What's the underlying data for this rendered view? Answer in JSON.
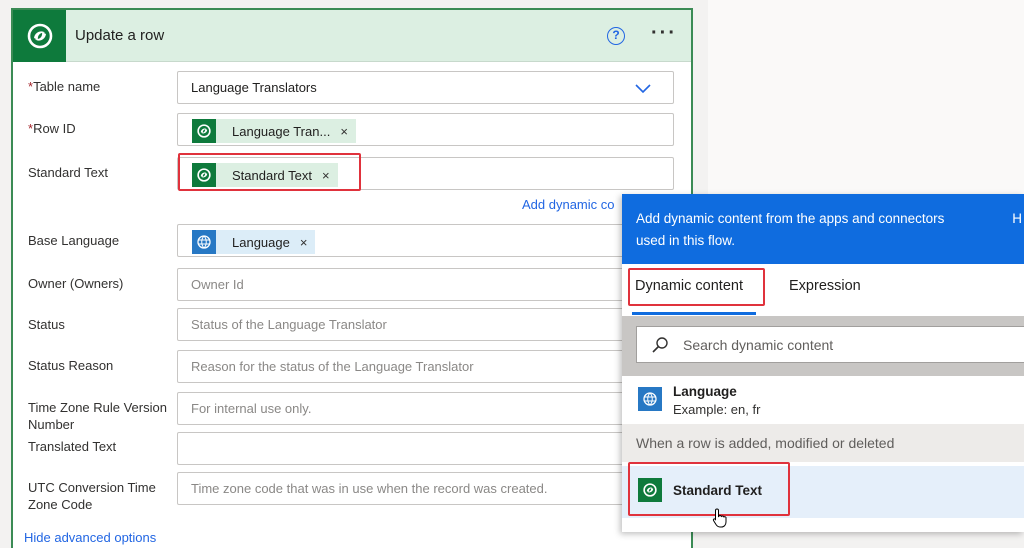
{
  "card": {
    "title": "Update a row",
    "help_glyph": "?",
    "more_glyph": "···",
    "required_mark": "*",
    "fields": {
      "table_name": {
        "label": "Table name",
        "value": "Language Translators"
      },
      "row_id": {
        "label": "Row ID",
        "token": "Language Tran...",
        "remove_glyph": "×"
      },
      "standard_text": {
        "label": "Standard Text",
        "token": "Standard Text",
        "remove_glyph": "×"
      },
      "add_dynamic": "Add dynamic co",
      "base_language": {
        "label": "Base Language",
        "token": "Language",
        "remove_glyph": "×"
      },
      "owner": {
        "label": "Owner (Owners)",
        "placeholder": "Owner Id"
      },
      "status": {
        "label": "Status",
        "placeholder": "Status of the Language Translator"
      },
      "status_reason": {
        "label": "Status Reason",
        "placeholder": "Reason for the status of the Language Translator"
      },
      "tz_rule": {
        "label_line1": "Time Zone Rule Version",
        "label_line2": "Number",
        "placeholder": "For internal use only."
      },
      "translated_text": {
        "label": "Translated Text",
        "placeholder": ""
      },
      "utc_conv": {
        "label_line1": "UTC Conversion Time",
        "label_line2": "Zone Code",
        "placeholder": "Time zone code that was in use when the record was created."
      }
    },
    "hide_advanced": "Hide advanced options"
  },
  "popup": {
    "header_line1": "Add dynamic content from the apps and connectors",
    "header_line2": "used in this flow.",
    "header_cut": "H",
    "tabs": {
      "dynamic": "Dynamic content",
      "expression": "Expression"
    },
    "search_placeholder": "Search dynamic content",
    "language_item": {
      "title": "Language",
      "subtitle": "Example: en, fr"
    },
    "section_title": "When a row is added, modified or deleted",
    "standard_text_item": {
      "title": "Standard Text"
    }
  },
  "colors": {
    "dataverse_green": "#0e7a3c",
    "language_blue": "#2778c4",
    "link_blue": "#2266e3",
    "highlight_red": "#e0323c"
  }
}
